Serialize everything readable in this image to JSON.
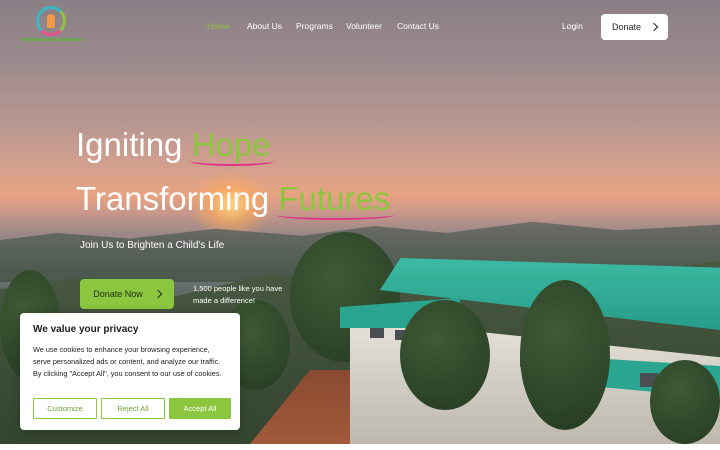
{
  "brand": {
    "logo_caption": "REACHING\nHUMANITY"
  },
  "nav": {
    "items": [
      {
        "label": "Home",
        "active": true
      },
      {
        "label": "About Us",
        "active": false
      },
      {
        "label": "Programs",
        "active": false
      },
      {
        "label": "Volunteer",
        "active": false
      },
      {
        "label": "Contact Us",
        "active": false
      }
    ],
    "login_label": "Login",
    "donate_label": "Donate"
  },
  "hero": {
    "line1_white": "Igniting ",
    "line1_green": "Hope",
    "line2_white": "Transforming ",
    "line2_green": "Futures",
    "subtitle": "Join Us to Brighten a Child's Life",
    "donate_now_label": "Donate Now",
    "people_text": "1,500 people like you have made a difference!"
  },
  "cookie_banner": {
    "title": "We value your privacy",
    "text": "We use cookies to enhance your browsing experience, serve personalized ads or content, and analyze our traffic. By clicking \"Accept All\", you consent to our use of cookies.",
    "customize_label": "Customize",
    "reject_label": "Reject All",
    "accept_label": "Accept All"
  },
  "colors": {
    "accent_green": "#8cc63f",
    "underline_pink": "#e0338a",
    "roof_teal": "#2aa58f"
  }
}
